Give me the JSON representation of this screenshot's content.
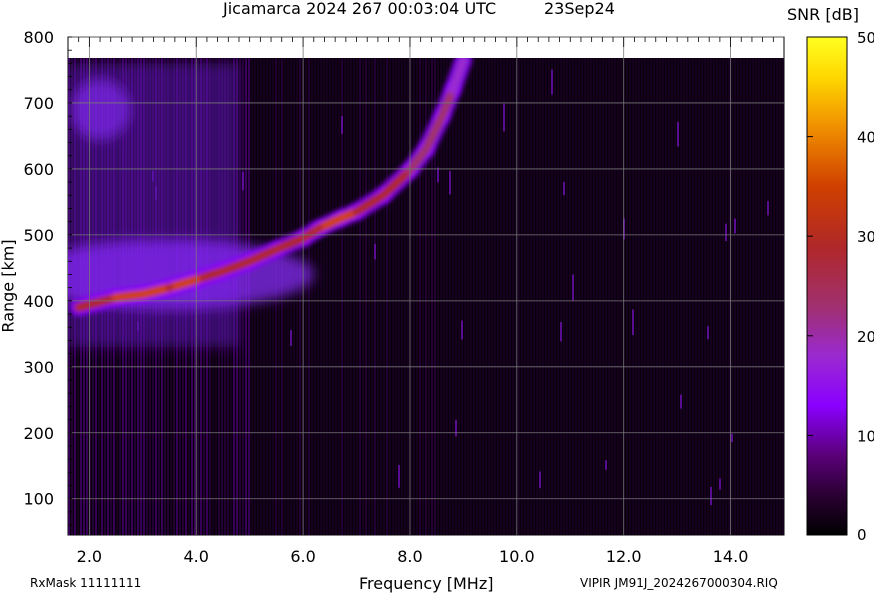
{
  "header": {
    "title": "Jicamarca 2024 267 00:03:04 UTC",
    "date": "23Sep24"
  },
  "footer": {
    "rxmask": "RxMask 11111111",
    "file": "VIPIR  JM91J_2024267000304.RIQ"
  },
  "chart_data": {
    "type": "heatmap",
    "title": "Jicamarca 2024 267 00:03:04 UTC",
    "subtitle": "23Sep24",
    "xlabel": "Frequency [MHz]",
    "ylabel": "Range [km]",
    "xlim": [
      1.6,
      15.0
    ],
    "ylim": [
      45,
      800
    ],
    "x_ticks": [
      "2.0",
      "4.0",
      "6.0",
      "8.0",
      "10.0",
      "12.0",
      "14.0"
    ],
    "x_tick_values": [
      2,
      4,
      6,
      8,
      10,
      12,
      14
    ],
    "y_ticks": [
      "100",
      "200",
      "300",
      "400",
      "500",
      "600",
      "700",
      "800"
    ],
    "y_tick_values": [
      100,
      200,
      300,
      400,
      500,
      600,
      700,
      800
    ],
    "grid": true,
    "data_top_km": 768,
    "colorbar": {
      "label": "SNR [dB]",
      "range": [
        0,
        50
      ],
      "ticks": [
        "0",
        "10",
        "20",
        "30",
        "40",
        "50"
      ],
      "tick_values": [
        0,
        10,
        20,
        30,
        40,
        50
      ],
      "colors": [
        "#000000",
        "#2a0033",
        "#5a0078",
        "#8a00ff",
        "#9a2ad0",
        "#a0306e",
        "#b02828",
        "#d04000",
        "#f09000",
        "#ffd800",
        "#ffff20"
      ]
    },
    "trace": {
      "description_points": [
        {
          "f": 1.8,
          "range": 390,
          "snr": 27
        },
        {
          "f": 2.5,
          "range": 405,
          "snr": 30
        },
        {
          "f": 3.0,
          "range": 410,
          "snr": 30
        },
        {
          "f": 3.5,
          "range": 420,
          "snr": 29
        },
        {
          "f": 4.0,
          "range": 432,
          "snr": 30
        },
        {
          "f": 4.5,
          "range": 445,
          "snr": 27
        },
        {
          "f": 5.0,
          "range": 460,
          "snr": 26
        },
        {
          "f": 5.5,
          "range": 478,
          "snr": 25
        },
        {
          "f": 6.0,
          "range": 495,
          "snr": 24
        },
        {
          "f": 6.3,
          "range": 510,
          "snr": 29
        },
        {
          "f": 6.7,
          "range": 525,
          "snr": 31
        },
        {
          "f": 7.0,
          "range": 535,
          "snr": 29
        },
        {
          "f": 7.5,
          "range": 560,
          "snr": 25
        },
        {
          "f": 8.0,
          "range": 598,
          "snr": 22
        },
        {
          "f": 8.3,
          "range": 630,
          "snr": 22
        },
        {
          "f": 8.6,
          "range": 680,
          "snr": 21
        },
        {
          "f": 8.8,
          "range": 720,
          "snr": 18
        },
        {
          "f": 9.0,
          "range": 765,
          "snr": 15
        }
      ]
    }
  }
}
